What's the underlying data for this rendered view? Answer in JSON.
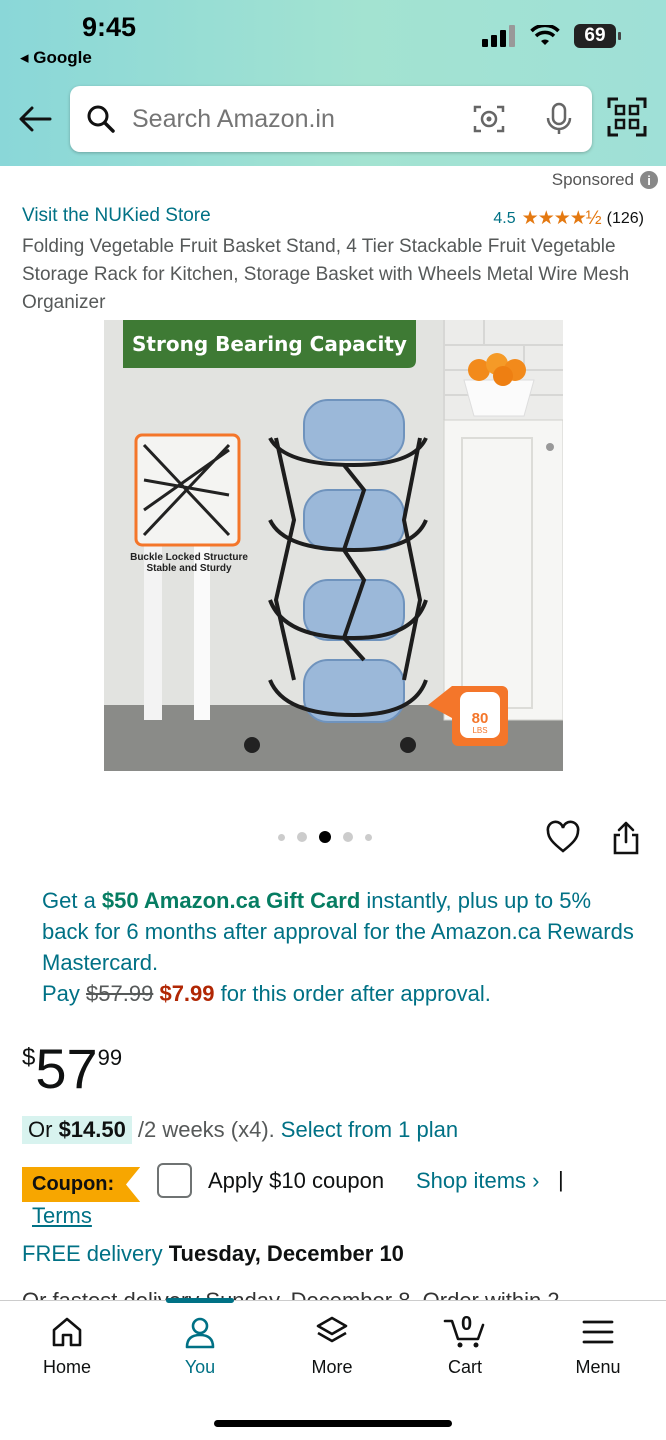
{
  "status": {
    "time": "9:45",
    "back_app": "Google",
    "battery": "69"
  },
  "search": {
    "placeholder": "Search Amazon.in"
  },
  "ad": {
    "sponsored": "Sponsored",
    "info": "i"
  },
  "product": {
    "store": "Visit the NUKied Store",
    "rating": "4.5",
    "stars": "★★★★½",
    "reviews": "(126)",
    "title": "Folding Vegetable Fruit Basket Stand, 4 Tier Stackable Fruit Vegetable Storage Rack for Kitchen, Storage Basket with Wheels Metal Wire Mesh Organizer",
    "image": {
      "banner": "Strong Bearing Capacity",
      "caption_line1": "Buckle Locked Structure",
      "caption_line2": "Stable and Sturdy",
      "weight": "80",
      "weight_unit": "LBS"
    }
  },
  "promo": {
    "text1": "Get a ",
    "gift": "$50 Amazon.ca Gift Card",
    "text2": " instantly, plus up to 5% back for 6 months after approval for the Amazon.ca Rewards Mastercard.",
    "pay": "Pay ",
    "old_price": "$57.99",
    "new_price": "$7.99",
    "text3": " for this order after approval."
  },
  "price": {
    "currency": "$",
    "whole": "57",
    "fraction": "99"
  },
  "plan": {
    "or": "Or ",
    "amount": "$14.50",
    "period": "/2 weeks (x4).",
    "link": "Select from 1 plan"
  },
  "coupon": {
    "label": "Coupon:",
    "apply": "Apply $10 coupon",
    "shop": "Shop items ›",
    "pipe": "|",
    "terms": "Terms"
  },
  "delivery": {
    "free": "FREE delivery",
    "date": "Tuesday, December 10",
    "fastest": "Or fastest delivery Sunday, December 8. Order within 2"
  },
  "tabs": [
    {
      "label": "Home"
    },
    {
      "label": "You"
    },
    {
      "label": "More"
    },
    {
      "label": "Cart",
      "count": "0"
    },
    {
      "label": "Menu"
    }
  ],
  "colors": {
    "accent": "#007185",
    "price_red": "#b12704",
    "coupon": "#f7a600",
    "banner_green": "#3e7a34",
    "badge_orange": "#f4762a"
  }
}
